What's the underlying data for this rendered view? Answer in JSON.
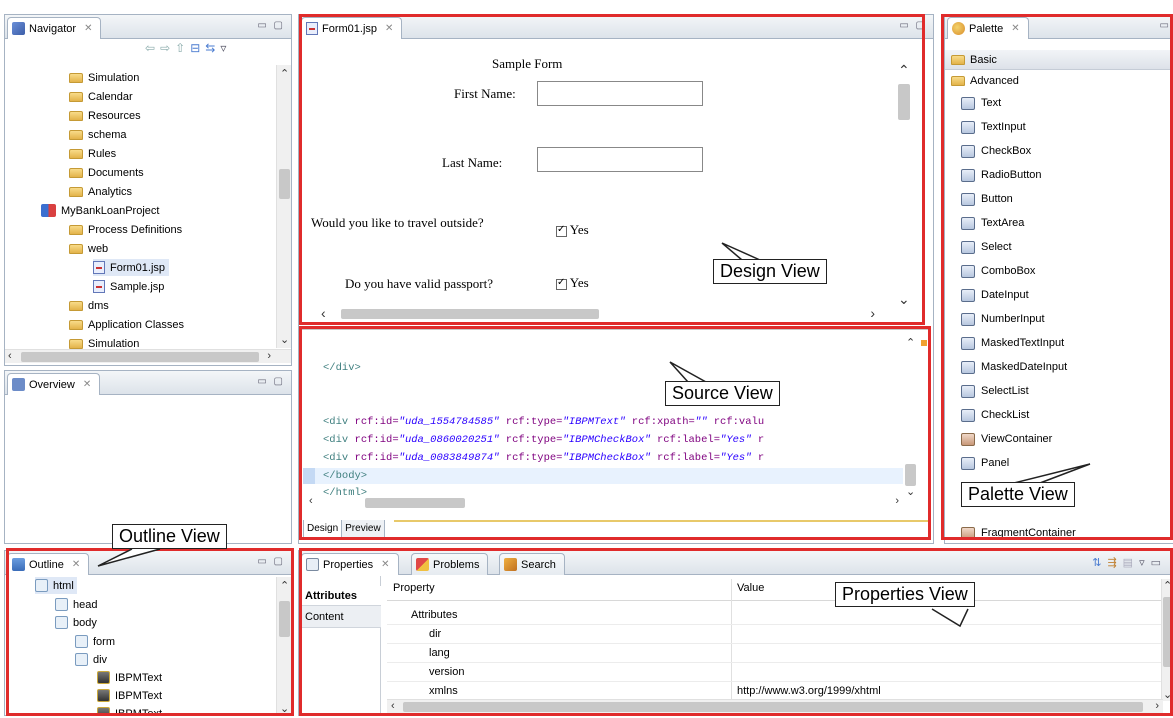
{
  "navigator": {
    "title": "Navigator",
    "items": [
      {
        "label": "Simulation",
        "icon": "folder-icon"
      },
      {
        "label": "Calendar",
        "icon": "folder-icon"
      },
      {
        "label": "Resources",
        "icon": "folder-icon"
      },
      {
        "label": "schema",
        "icon": "folder-icon"
      },
      {
        "label": "Rules",
        "icon": "folder-icon"
      },
      {
        "label": "Documents",
        "icon": "folder-icon"
      },
      {
        "label": "Analytics",
        "icon": "folder-icon"
      },
      {
        "label": "MyBankLoanProject",
        "icon": "project-icon"
      },
      {
        "label": "Process Definitions",
        "icon": "folder-icon"
      },
      {
        "label": "web",
        "icon": "folder-icon"
      },
      {
        "label": "Form01.jsp",
        "icon": "jsp-file-icon"
      },
      {
        "label": "Sample.jsp",
        "icon": "jsp-file-icon"
      },
      {
        "label": "dms",
        "icon": "folder-icon"
      },
      {
        "label": "Application Classes",
        "icon": "folder-icon"
      },
      {
        "label": "Simulation",
        "icon": "folder-icon"
      }
    ]
  },
  "overview": {
    "title": "Overview"
  },
  "outline": {
    "title": "Outline",
    "items": [
      {
        "label": "html"
      },
      {
        "label": "head"
      },
      {
        "label": "body"
      },
      {
        "label": "form"
      },
      {
        "label": "div"
      },
      {
        "label": "IBPMText"
      },
      {
        "label": "IBPMText"
      },
      {
        "label": "IBPMText"
      }
    ]
  },
  "editor": {
    "tab_title": "Form01.jsp",
    "form": {
      "title": "Sample Form",
      "first_name_label": "First Name:",
      "last_name_label": "Last Name:",
      "travel_question": "Would you like to travel outside?",
      "travel_answer": "Yes",
      "passport_question": "Do you have valid passport?",
      "passport_answer": "Yes"
    },
    "source": {
      "line1": "</div>",
      "line2_tag": "<div",
      "line2_attr1": " rcf:id=",
      "line2_val1": "\"uda_1554784585\"",
      "line2_attr2": " rcf:type=",
      "line2_val2": "\"IBPMText\"",
      "line2_attr3": " rcf:xpath=",
      "line2_val3": "\"\"",
      "line2_attr4": " rcf:valu",
      "line3_tag": "<div",
      "line3_attr1": " rcf:id=",
      "line3_val1": "\"uda_0860020251\"",
      "line3_attr2": " rcf:type=",
      "line3_val2": "\"IBPMCheckBox\"",
      "line3_attr3": " rcf:label=",
      "line3_val3": "\"Yes\"",
      "line3_rest": " r",
      "line4_tag": "<div",
      "line4_attr1": " rcf:id=",
      "line4_val1": "\"uda_0083849874\"",
      "line4_attr2": " rcf:type=",
      "line4_val2": "\"IBPMCheckBox\"",
      "line4_attr3": " rcf:label=",
      "line4_val3": "\"Yes\"",
      "line4_rest": " r",
      "line5": "</body>",
      "line6": "</html>"
    },
    "bottom_tabs": [
      "Design",
      "Preview"
    ]
  },
  "palette": {
    "title": "Palette",
    "drawers": [
      "Basic",
      "Advanced"
    ],
    "items": [
      "Text",
      "TextInput",
      "CheckBox",
      "RadioButton",
      "Button",
      "TextArea",
      "Select",
      "ComboBox",
      "DateInput",
      "NumberInput",
      "MaskedTextInput",
      "MaskedDateInput",
      "SelectList",
      "CheckList",
      "ViewContainer",
      "Panel",
      "FragmentContainer"
    ]
  },
  "properties": {
    "tabs": [
      "Properties",
      "Problems",
      "Search"
    ],
    "side_tabs": [
      "Attributes",
      "Content"
    ],
    "col_property": "Property",
    "col_value": "Value",
    "rows": [
      {
        "property": "Attributes",
        "value": ""
      },
      {
        "property": "dir",
        "value": ""
      },
      {
        "property": "lang",
        "value": ""
      },
      {
        "property": "version",
        "value": ""
      },
      {
        "property": "xmlns",
        "value": "http://www.w3.org/1999/xhtml"
      }
    ]
  },
  "callouts": {
    "design": "Design View",
    "source": "Source View",
    "palette": "Palette View",
    "outline": "Outline View",
    "properties": "Properties View"
  },
  "colors": {
    "highlight_box": "#e02b2b",
    "selection": "#dfe8f6"
  }
}
